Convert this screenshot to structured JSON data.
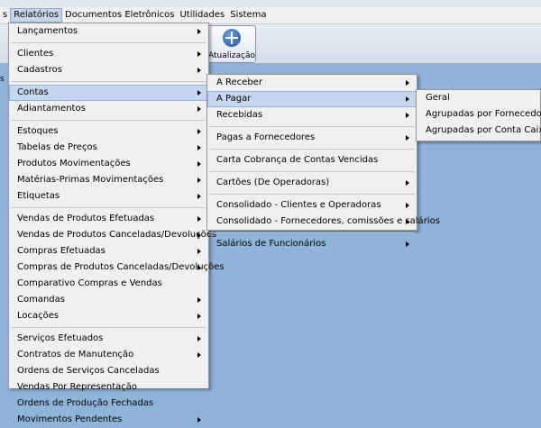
{
  "menubar": {
    "items": [
      {
        "label": "s"
      },
      {
        "label": "Relatórios"
      },
      {
        "label": "Documentos Eletrônicos"
      },
      {
        "label": "Utilidades"
      },
      {
        "label": "Sistema"
      }
    ]
  },
  "toolbar": {
    "left_label": "s",
    "update_label": "Atualização"
  },
  "reports_menu": {
    "items": [
      {
        "label": "Lançamentos"
      },
      {
        "label": "Clientes"
      },
      {
        "label": "Cadastros"
      },
      {
        "label": "Contas"
      },
      {
        "label": "Adiantamentos"
      },
      {
        "label": "Estoques"
      },
      {
        "label": "Tabelas de Preços"
      },
      {
        "label": "Produtos Movimentações"
      },
      {
        "label": "Matérias-Primas Movimentações"
      },
      {
        "label": "Etiquetas"
      },
      {
        "label": "Vendas de Produtos Efetuadas"
      },
      {
        "label": "Vendas de Produtos Canceladas/Devoluções"
      },
      {
        "label": "Compras Efetuadas"
      },
      {
        "label": "Compras de Produtos Canceladas/Devoluções"
      },
      {
        "label": "Comparativo Compras e Vendas"
      },
      {
        "label": "Comandas"
      },
      {
        "label": "Locações"
      },
      {
        "label": "Serviços Efetuados"
      },
      {
        "label": "Contratos de Manutenção"
      },
      {
        "label": "Ordens de Serviços Canceladas"
      },
      {
        "label": "Vendas Por Representação"
      },
      {
        "label": "Ordens de Produção Fechadas"
      },
      {
        "label": "Movimentos Pendentes"
      }
    ]
  },
  "contas_menu": {
    "items": [
      {
        "label": "A Receber"
      },
      {
        "label": "A Pagar"
      },
      {
        "label": "Recebidas"
      },
      {
        "label": "Pagas a Fornecedores"
      },
      {
        "label": "Carta Cobrança de Contas Vencidas"
      },
      {
        "label": "Cartões (De Operadoras)"
      },
      {
        "label": "Consolidado - Clientes e Operadoras"
      },
      {
        "label": "Consolidado - Fornecedores, comissões e salários"
      },
      {
        "label": "Salários de Funcionários"
      }
    ]
  },
  "apagar_menu": {
    "items": [
      {
        "label": "Geral"
      },
      {
        "label": "Agrupadas por Fornecedor"
      },
      {
        "label": "Agrupadas por Conta Caixa"
      }
    ]
  }
}
